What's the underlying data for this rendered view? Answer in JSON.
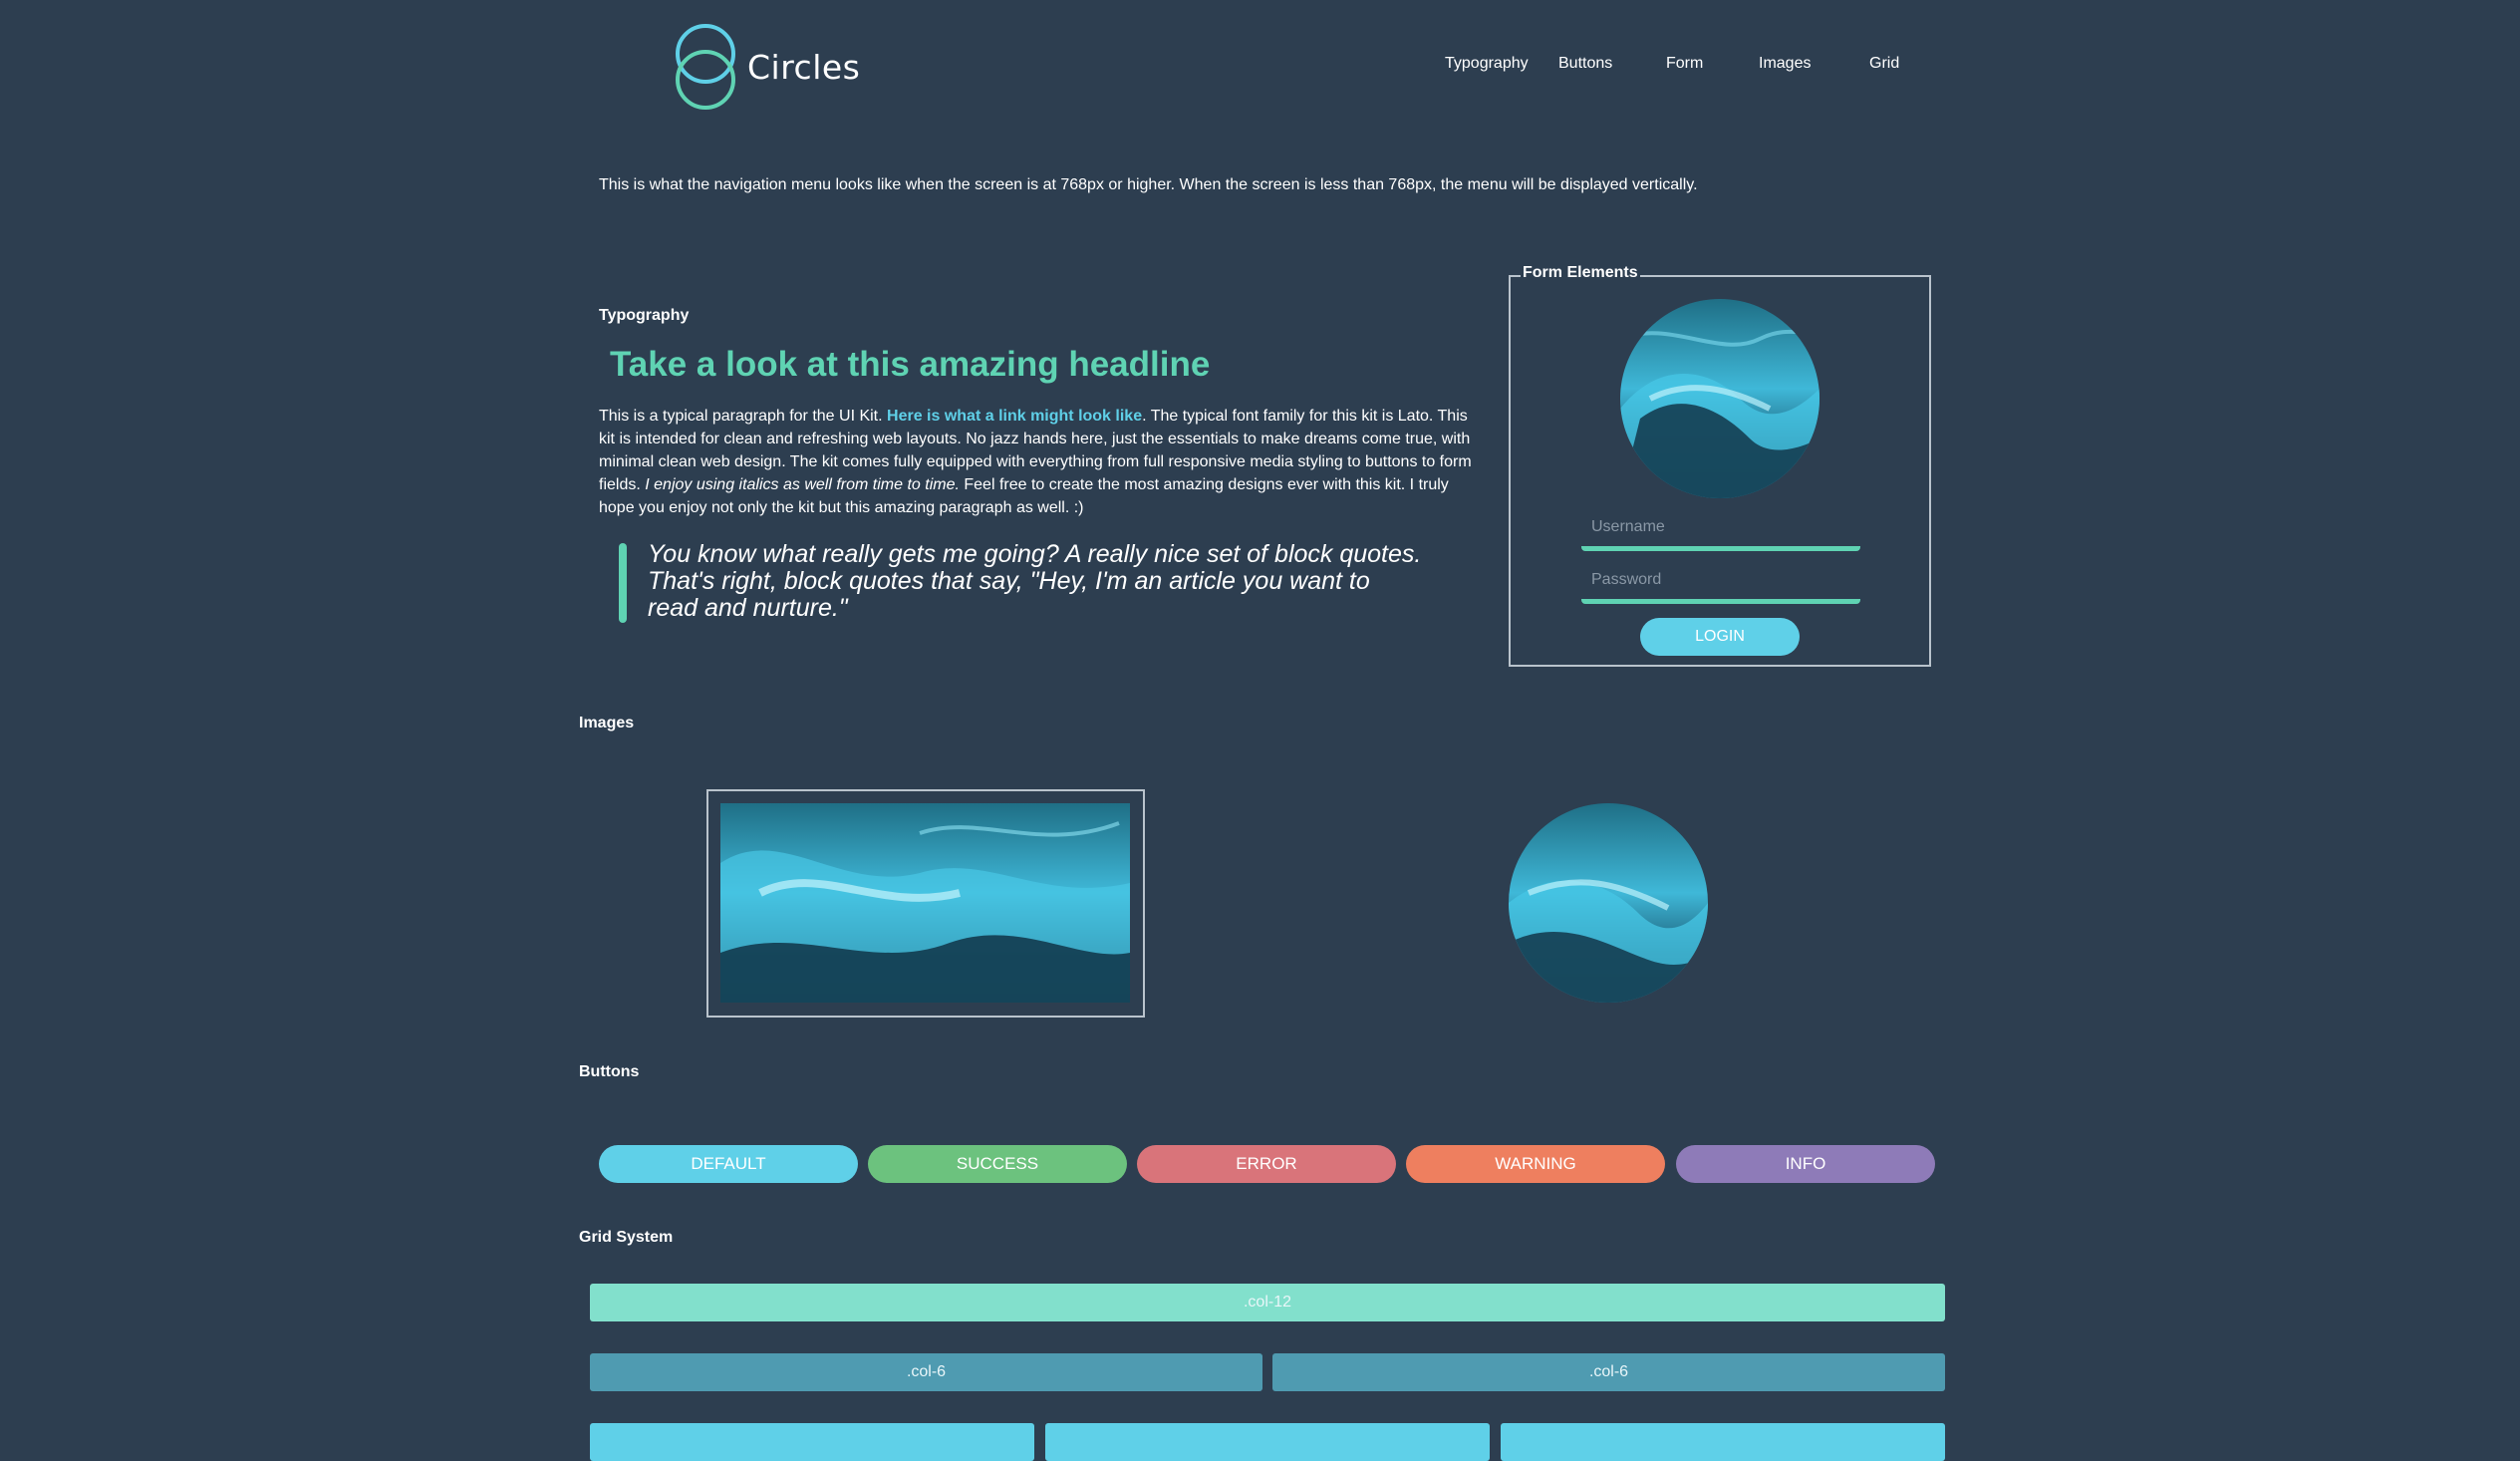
{
  "header": {
    "logo_text": "Circles",
    "nav": [
      "Typography",
      "Buttons",
      "Form",
      "Images",
      "Grid"
    ]
  },
  "note": "This is what the navigation menu looks like when the screen is at 768px or higher. When the screen is less than 768px, the menu will be displayed vertically.",
  "typography": {
    "label": "Typography",
    "headline": "Take a look at this amazing headline",
    "para_1": "This is a typical paragraph for the UI Kit. ",
    "link": "Here is what a link might look like",
    "para_2": ". The typical font family for this kit is Lato. This kit is intended for clean and refreshing web layouts. No jazz hands here, just the essentials to make dreams come true, with minimal clean web design. The kit comes fully equipped with everything from full responsive media styling to buttons to form fields. ",
    "italic": "I enjoy using italics as well from time to time.",
    "para_3": " Feel free to create the most amazing designs ever with this kit. I truly hope you enjoy not only the kit but this amazing paragraph as well. :)",
    "quote": "You know what really gets me going? A really nice set of block quotes. That's right, block quotes that say, \"Hey, I'm an article you want to read and nurture.\""
  },
  "form": {
    "legend": "Form Elements",
    "username_placeholder": "Username",
    "password_placeholder": "Password",
    "login_label": "LOGIN"
  },
  "images": {
    "label": "Images"
  },
  "buttons": {
    "label": "Buttons",
    "items": [
      {
        "label": "DEFAULT",
        "color": "#5fd0e8"
      },
      {
        "label": "SUCCESS",
        "color": "#6cc27e"
      },
      {
        "label": "ERROR",
        "color": "#d9747a"
      },
      {
        "label": "WARNING",
        "color": "#ee7f5f"
      },
      {
        "label": "INFO",
        "color": "#8e7bb8"
      }
    ]
  },
  "grid": {
    "label": "Grid System",
    "col12": ".col-12",
    "col6": ".col-6",
    "colors": {
      "col12": "#82e0cc",
      "col6": "#4f9bb1",
      "col4": "#5fd0e8"
    }
  },
  "colors": {
    "background": "#2d3e50",
    "accent": "#5fd3b3",
    "link": "#5fd0e8"
  }
}
